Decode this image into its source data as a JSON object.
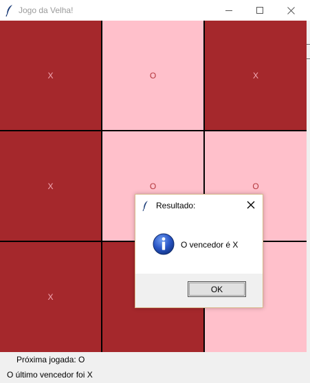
{
  "window": {
    "title": "Jogo da Velha!",
    "controls": [
      "minimize",
      "maximize",
      "close"
    ]
  },
  "board": {
    "cells": [
      {
        "mark": "X",
        "color": "#a5282c"
      },
      {
        "mark": "O",
        "color": "#ffc0cb"
      },
      {
        "mark": "X",
        "color": "#a5282c"
      },
      {
        "mark": "X",
        "color": "#a5282c"
      },
      {
        "mark": "O",
        "color": "#ffc0cb"
      },
      {
        "mark": "O",
        "color": "#ffc0cb"
      },
      {
        "mark": "X",
        "color": "#a5282c"
      },
      {
        "mark": "",
        "color": "#a5282c"
      },
      {
        "mark": "",
        "color": "#ffc0cb"
      }
    ]
  },
  "status": {
    "next_move": "Próxima jogada: O",
    "last_winner": "O último vencedor foi X"
  },
  "dialog": {
    "title": "Resultado:",
    "message": "O vencedor é X",
    "ok_label": "OK",
    "icon": "info-icon"
  }
}
